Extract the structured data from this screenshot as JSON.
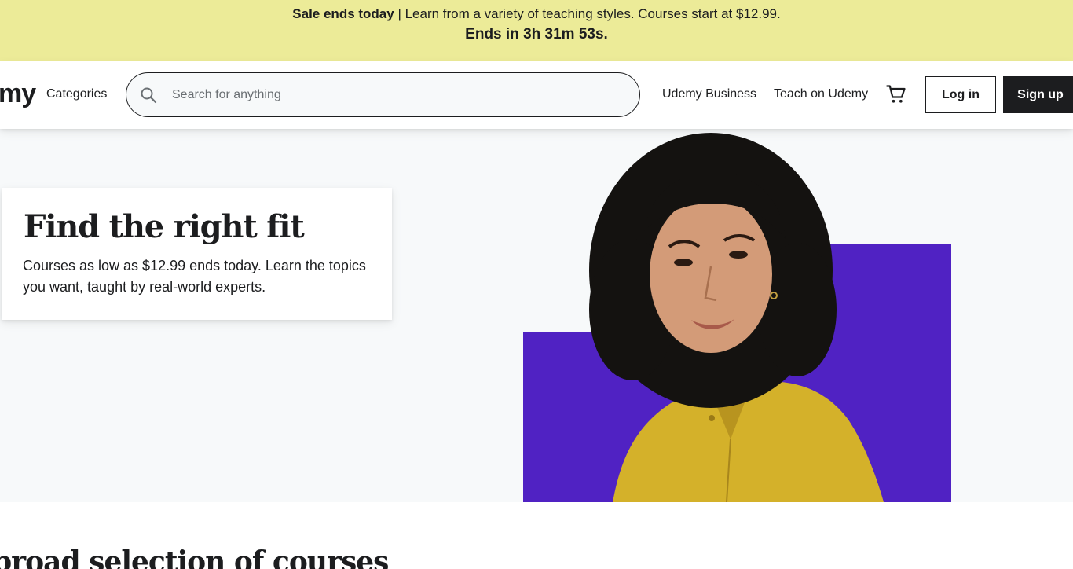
{
  "banner": {
    "bold": "Sale ends today",
    "message": " | Learn from a variety of teaching styles. Courses start at $12.99.",
    "countdown": "Ends in 3h 31m 53s.",
    "background": "#eceb98"
  },
  "header": {
    "logo": "my",
    "categories": "Categories",
    "search_placeholder": "Search for anything",
    "business": "Udemy Business",
    "teach": "Teach on Udemy",
    "login": "Log in",
    "signup": "Sign up"
  },
  "hero": {
    "title": "Find the right fit",
    "text": "Courses as low as $12.99 ends today. Learn the topics you want, taught by real-world experts.",
    "accent_color": "#5022c3",
    "shirt_color": "#d4b12a"
  },
  "section": {
    "title": "broad selection of courses"
  },
  "icons": {
    "search": "search-icon",
    "cart": "cart-icon"
  }
}
